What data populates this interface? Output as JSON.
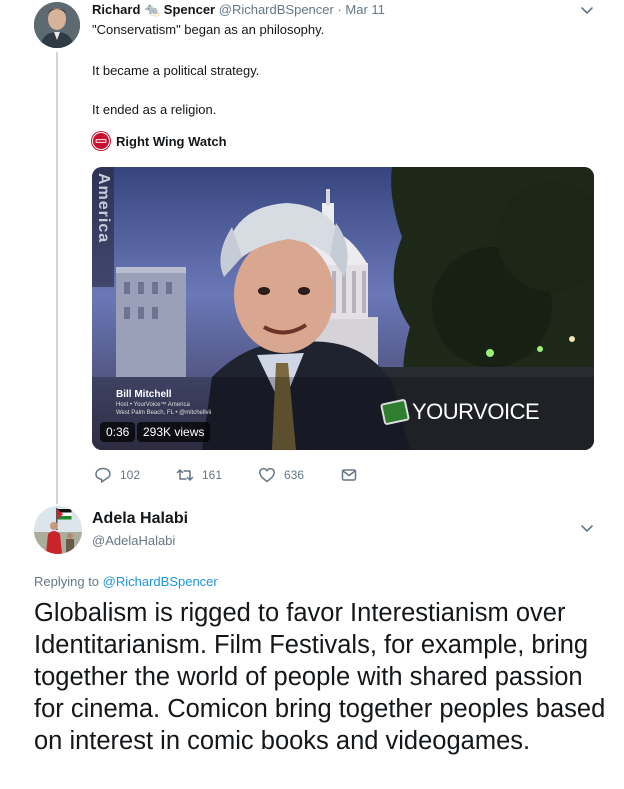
{
  "tweet1": {
    "author_name": "Richard 🐀 Spencer",
    "handle_and_date": "@RichardBSpencer · Mar 11",
    "lines": [
      "\"Conservatism\" began as an philosophy.",
      "It became a political strategy.",
      "It ended as a religion."
    ],
    "embedded_account": "Right Wing Watch",
    "embedded_logo_text": "RIGHT WING WATCH",
    "video": {
      "vertical_label": "America",
      "lower_third_name": "Bill Mitchell",
      "lower_third_sub1": "Host • YourVoice™ America",
      "lower_third_sub2": "West Palm Beach, FL • @mitchellvii",
      "brand_logo": "YOURVOICE",
      "duration": "0:36",
      "views": "293K views"
    },
    "actions": {
      "reply_count": "102",
      "retweet_count": "161",
      "like_count": "636"
    }
  },
  "tweet2": {
    "author_name": "Adela Halabi",
    "handle": "@AdelaHalabi",
    "replying_prefix": "Replying to ",
    "replying_to": "@RichardBSpencer",
    "body": "Globalism is rigged to favor Interestianism over Identitarianism.  Film  Festivals, for example, bring together the world of people with shared  passion for cinema. Comicon bring together peoples based on interest in comic books and videogames."
  }
}
